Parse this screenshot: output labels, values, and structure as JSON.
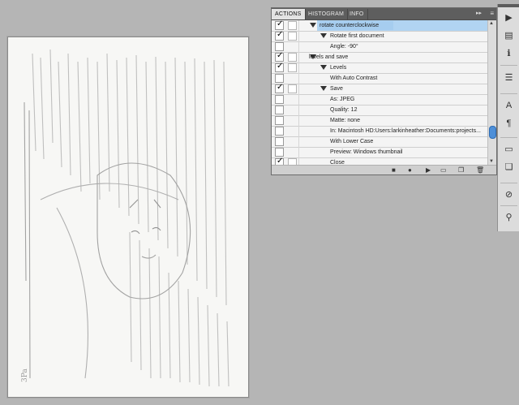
{
  "panel": {
    "tabs": [
      {
        "label": "ACTIONS",
        "active": true
      },
      {
        "label": "HISTOGRAM",
        "active": false
      },
      {
        "label": "INFO",
        "active": false
      }
    ],
    "menu_glyph": "≡",
    "collapse_glyph": "▸▸",
    "rows": [
      {
        "text": "rotate counterclockwise",
        "level": 1,
        "expanded": true,
        "checked": true,
        "selected": true
      },
      {
        "text": "Rotate first document",
        "level": 2,
        "expanded": true,
        "checked": true
      },
      {
        "text": "Angle: -90°",
        "level": 3,
        "checked": false
      },
      {
        "text": "levels and save",
        "level": 0,
        "expanded": true,
        "checked": true
      },
      {
        "text": "Levels",
        "level": 2,
        "expanded": true,
        "checked": true
      },
      {
        "text": "With Auto Contrast",
        "level": 3,
        "checked": false
      },
      {
        "text": "Save",
        "level": 2,
        "expanded": true,
        "checked": true
      },
      {
        "text": "As: JPEG",
        "level": 3,
        "checked": false
      },
      {
        "text": "Quality: 12",
        "level": 3,
        "checked": false
      },
      {
        "text": "Matte: none",
        "level": 3,
        "checked": false
      },
      {
        "text": "In: Macintosh HD:Users:larkinheather:Documents:projects...",
        "level": 3,
        "checked": false
      },
      {
        "text": "With Lower Case",
        "level": 3,
        "checked": false
      },
      {
        "text": "Preview: Windows thumbnail",
        "level": 3,
        "checked": false
      },
      {
        "text": "Close",
        "level": 2,
        "checked": true
      }
    ],
    "footer_buttons": [
      {
        "name": "stop-button",
        "glyph": "■"
      },
      {
        "name": "record-button",
        "glyph": "●"
      },
      {
        "name": "play-button",
        "glyph": "▶"
      },
      {
        "name": "new-set-button",
        "glyph": "▭"
      },
      {
        "name": "new-action-button",
        "glyph": "❐"
      },
      {
        "name": "delete-button",
        "glyph": "🗑"
      }
    ]
  },
  "document": {
    "caption": "3Pa"
  },
  "dock": {
    "buttons": [
      {
        "name": "actions-panel-icon",
        "glyph": "▶"
      },
      {
        "name": "image-icon",
        "glyph": "▤"
      },
      {
        "name": "info-icon",
        "glyph": "ℹ"
      },
      {
        "name": "layers-icon",
        "glyph": "☰"
      },
      {
        "name": "character-icon",
        "glyph": "A"
      },
      {
        "name": "paragraph-icon",
        "glyph": "¶"
      },
      {
        "name": "notes-icon",
        "glyph": "▭"
      },
      {
        "name": "clone-source-icon",
        "glyph": "❏"
      },
      {
        "name": "brush-icon",
        "glyph": "⊘"
      },
      {
        "name": "tool-presets-icon",
        "glyph": "⚲"
      }
    ]
  }
}
